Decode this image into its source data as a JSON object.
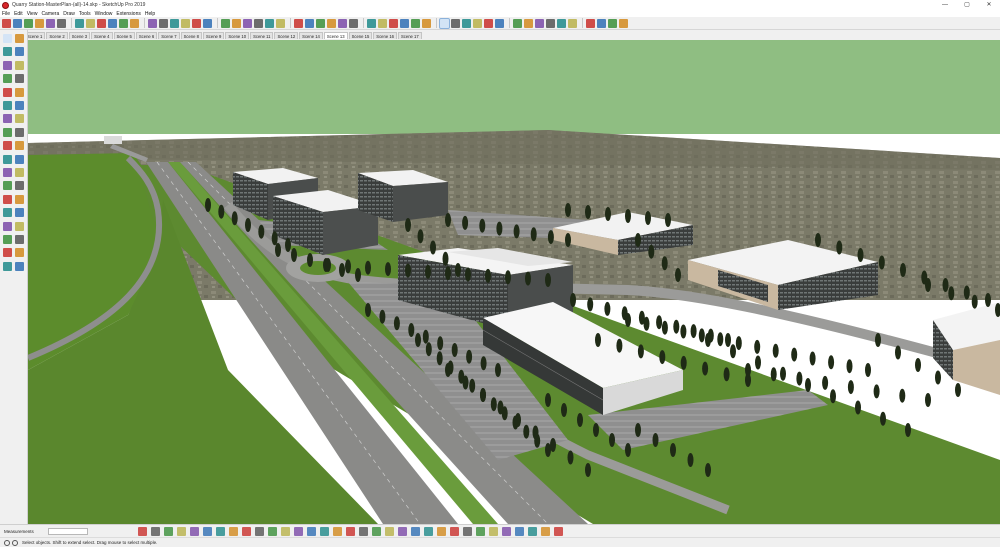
{
  "window": {
    "title": "Quarry Station-MasterPlan-(all)-14.skp - SketchUp Pro 2019",
    "minimize": "—",
    "maximize": "▢",
    "close": "✕"
  },
  "menu": [
    "File",
    "Edit",
    "View",
    "Camera",
    "Draw",
    "Tools",
    "Window",
    "Extensions",
    "Help"
  ],
  "scenes": [
    "Scene 1",
    "Scene 2",
    "Scene 3",
    "Scene 4",
    "Scene 5",
    "Scene 6",
    "Scene 7",
    "Scene 8",
    "Scene 9",
    "Scene 10",
    "Scene 11",
    "Scene 12",
    "Scene 14",
    "Scene 13",
    "Scene 15",
    "Scene 16",
    "Scene 17"
  ],
  "selected_scene": "Scene 13",
  "measurements": {
    "label": "Measurements",
    "value": ""
  },
  "status": {
    "text": "Select objects. Shift to extend select. Drag mouse to select multiple."
  },
  "colors": {
    "sky": "#8fbe82",
    "ground": "#7d7d6a",
    "grass": "#5c8a2f",
    "road": "#8a8a8a",
    "building_roof": "#f4f4f4",
    "tree": "#1f2a16"
  },
  "toolbar_icons": [
    "select-tool-icon",
    "eraser-icon",
    "paint-bucket-icon",
    "orbit-icon",
    "pan-icon",
    "zoom-icon",
    "zoom-window-icon",
    "zoom-extents-icon",
    "previous-view-icon",
    "next-view-icon",
    "line-icon",
    "freehand-icon",
    "rectangle-icon",
    "rotated-rectangle-icon",
    "circle-icon",
    "polygon-icon",
    "arc-icon",
    "pie-icon",
    "push-pull-icon",
    "follow-me-icon",
    "offset-icon",
    "move-icon",
    "rotate-icon",
    "scale-icon",
    "tape-measure-icon",
    "protractor-icon",
    "text-icon",
    "axes-icon",
    "dimension-icon",
    "3d-text-icon",
    "iso-view-icon",
    "top-view-icon",
    "front-view-icon",
    "right-view-icon",
    "back-view-icon",
    "left-view-icon",
    "select-cursor-icon",
    "walk-icon",
    "look-around-icon",
    "position-camera-icon",
    "section-plane-icon",
    "display-section-icon",
    "xray-icon",
    "wireframe-icon",
    "hidden-line-icon",
    "shaded-icon",
    "textured-icon",
    "monochrome-icon",
    "get-models-icon",
    "share-model-icon",
    "extension-warehouse-icon",
    "layout-icon"
  ],
  "left_tool_icons": [
    "select-icon",
    "make-component-icon",
    "paint-icon",
    "eraser-icon",
    "line-icon",
    "freehand-icon",
    "rectangle-icon",
    "rotated-rect-icon",
    "circle-icon",
    "polygon-icon",
    "arc-icon",
    "two-point-arc-icon",
    "three-point-arc-icon",
    "pie-icon",
    "move-icon",
    "push-pull-icon",
    "rotate-icon",
    "follow-me-icon",
    "scale-icon",
    "offset-icon",
    "tape-icon",
    "dimension-icon",
    "protractor-icon",
    "text-icon",
    "axes-icon",
    "3d-text-icon",
    "orbit-icon",
    "pan-icon",
    "zoom-icon",
    "zoom-window-icon",
    "zoom-extents-icon",
    "previous-icon",
    "position-camera-icon",
    "look-around-icon",
    "walk-icon",
    "section-plane-icon"
  ],
  "bottom_tool_icons": [
    "move-axis-icon",
    "solid-tools-icon",
    "outer-shell-icon",
    "intersect-icon",
    "union-icon",
    "subtract-icon",
    "trim-icon",
    "split-icon",
    "sandbox-icon",
    "smoove-icon",
    "stamp-icon",
    "drape-icon",
    "add-detail-icon",
    "flip-edge-icon",
    "camera-icon",
    "advanced-camera-icon",
    "dynamic-component-icon",
    "interact-icon",
    "component-options-icon",
    "component-attributes-icon",
    "location-icon",
    "toggle-terrain-icon",
    "photo-texture-icon",
    "style-builder-icon",
    "warehouse-icon",
    "share-component-icon",
    "layer-icon",
    "shadow-icon",
    "fog-icon",
    "match-photo-icon",
    "outliner-icon",
    "scenes-icon",
    "materials-icon"
  ]
}
